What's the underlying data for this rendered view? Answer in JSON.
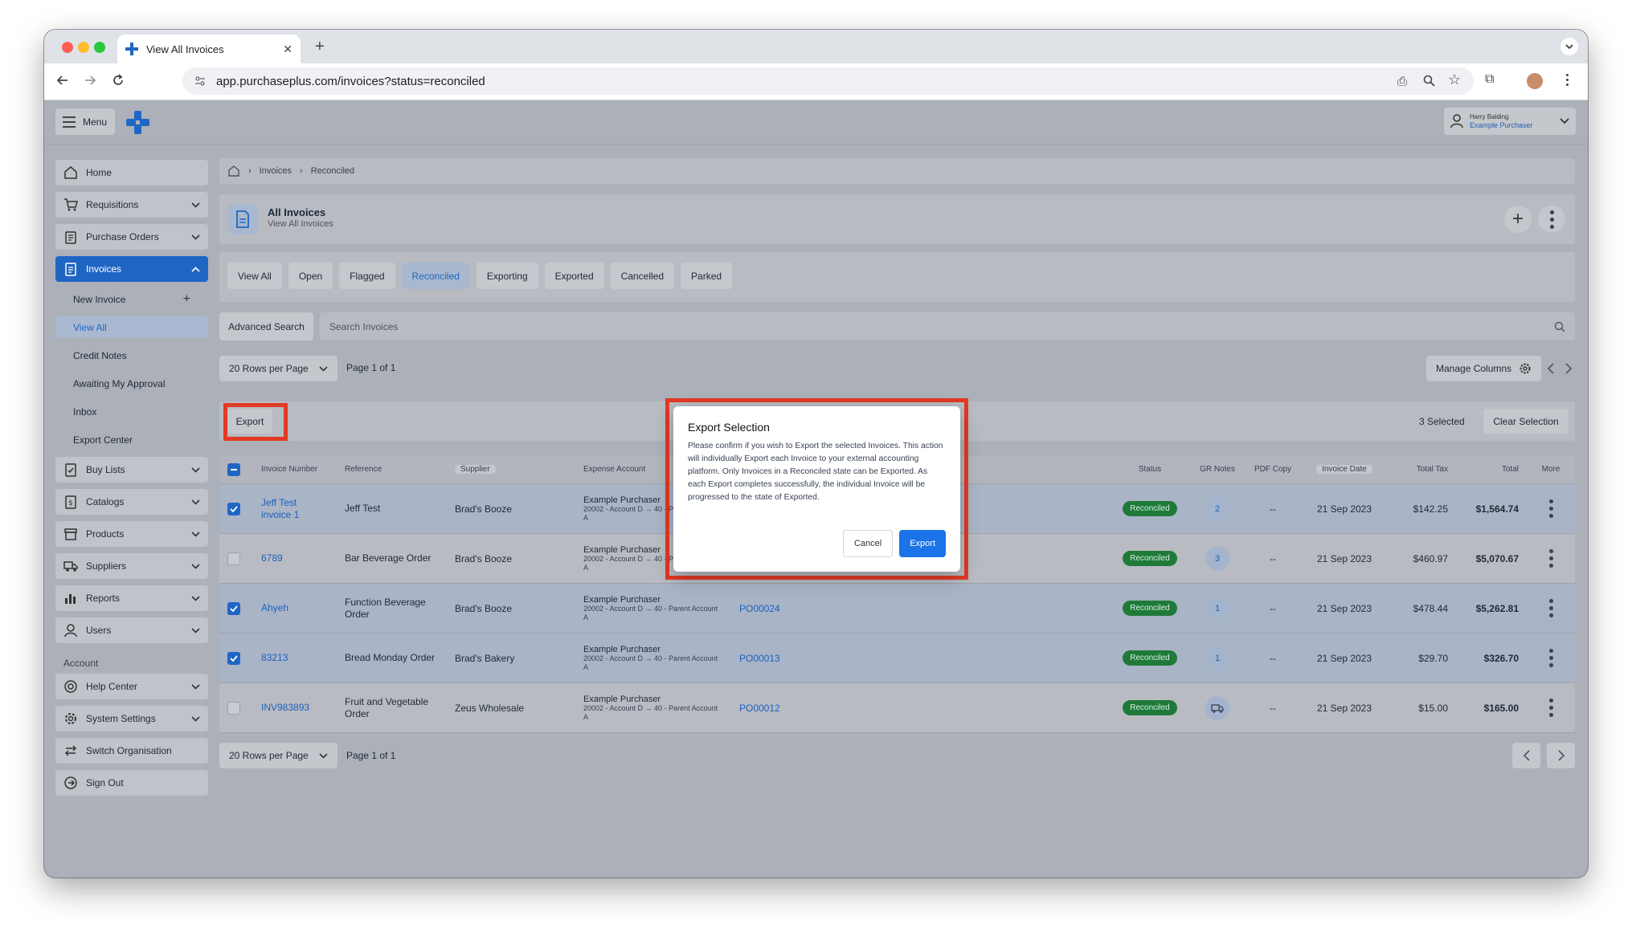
{
  "browser": {
    "tab_title": "View All Invoices",
    "url": "app.purchaseplus.com/invoices?status=reconciled"
  },
  "topbar": {
    "menu_label": "Menu",
    "user_name": "Harry Balding",
    "org_name": "Example Purchaser"
  },
  "sidebar": {
    "items": [
      {
        "label": "Home"
      },
      {
        "label": "Requisitions"
      },
      {
        "label": "Purchase Orders"
      },
      {
        "label": "Invoices"
      }
    ],
    "invoice_sub": [
      {
        "label": "New Invoice"
      },
      {
        "label": "View All"
      },
      {
        "label": "Credit Notes"
      },
      {
        "label": "Awaiting My Approval"
      },
      {
        "label": "Inbox"
      },
      {
        "label": "Export Center"
      }
    ],
    "items2": [
      {
        "label": "Buy Lists"
      },
      {
        "label": "Catalogs"
      },
      {
        "label": "Products"
      },
      {
        "label": "Suppliers"
      },
      {
        "label": "Reports"
      },
      {
        "label": "Users"
      }
    ],
    "account_label": "Account",
    "account_items": [
      {
        "label": "Help Center"
      },
      {
        "label": "System Settings"
      },
      {
        "label": "Switch Organisation"
      },
      {
        "label": "Sign Out"
      }
    ]
  },
  "breadcrumb": {
    "items": [
      "Invoices",
      "Reconciled"
    ]
  },
  "header": {
    "title": "All Invoices",
    "subtitle": "View All Invoices"
  },
  "filters": [
    "View All",
    "Open",
    "Flagged",
    "Reconciled",
    "Exporting",
    "Exported",
    "Cancelled",
    "Parked"
  ],
  "search": {
    "advanced_label": "Advanced Search",
    "placeholder": "Search Invoices"
  },
  "pagination": {
    "rows_label": "20 Rows per Page",
    "page_label": "Page 1 of 1",
    "manage_columns": "Manage Columns"
  },
  "selection": {
    "export_label": "Export",
    "selected_count": "3 Selected",
    "clear_label": "Clear Selection"
  },
  "table": {
    "columns": [
      "Invoice Number",
      "Reference",
      "Supplier",
      "Expense Account",
      "Status",
      "GR Notes",
      "PDF Copy",
      "Invoice Date",
      "Total Tax",
      "Total",
      "More"
    ],
    "rows": [
      {
        "number": "Jeff Test invoice 1",
        "reference": "Jeff Test",
        "supplier": "Brad's Booze",
        "acct_name": "Example Purchaser",
        "acct_detail": "20002 - Account D → 40 - Parent Account A",
        "po": "",
        "status": "Reconciled",
        "gr": "2",
        "pdf": "--",
        "date": "21 Sep 2023",
        "tax": "$142.25",
        "total": "$1,564.74",
        "checked": true
      },
      {
        "number": "6789",
        "reference": "Bar Beverage Order",
        "supplier": "Brad's Booze",
        "acct_name": "Example Purchaser",
        "acct_detail": "20002 - Account D → 40 - Parent Account A",
        "po": "",
        "status": "Reconciled",
        "gr": "3",
        "pdf": "--",
        "date": "21 Sep 2023",
        "tax": "$460.97",
        "total": "$5,070.67",
        "checked": false
      },
      {
        "number": "Ahyeh",
        "reference": "Function Beverage Order",
        "supplier": "Brad's Booze",
        "acct_name": "Example Purchaser",
        "acct_detail": "20002 - Account D → 40 - Parent Account A",
        "po": "PO00024",
        "status": "Reconciled",
        "gr": "1",
        "pdf": "--",
        "date": "21 Sep 2023",
        "tax": "$478.44",
        "total": "$5,262.81",
        "checked": true
      },
      {
        "number": "83213",
        "reference": "Bread Monday Order",
        "supplier": "Brad's Bakery",
        "acct_name": "Example Purchaser",
        "acct_detail": "20002 - Account D → 40 - Parent Account A",
        "po": "PO00013",
        "status": "Reconciled",
        "gr": "1",
        "pdf": "--",
        "date": "21 Sep 2023",
        "tax": "$29.70",
        "total": "$326.70",
        "checked": true
      },
      {
        "number": "INV983893",
        "reference": "Fruit and Vegetable Order",
        "supplier": "Zeus Wholesale",
        "acct_name": "Example Purchaser",
        "acct_detail": "20002 - Account D → 40 - Parent Account A",
        "po": "PO00012",
        "status": "Reconciled",
        "gr": "",
        "pdf": "--",
        "date": "21 Sep 2023",
        "tax": "$15.00",
        "total": "$165.00",
        "checked": false
      }
    ]
  },
  "modal": {
    "title": "Export Selection",
    "body": "Please confirm if you wish to Export the selected Invoices. This action will individually Export each Invoice to your external accounting platform. Only Invoices in a Reconciled state can be Exported. As each Export completes successfully, the individual Invoice will be progressed to the state of Exported.",
    "cancel": "Cancel",
    "confirm": "Export"
  },
  "colors": {
    "accent": "#1f66c4",
    "status_green": "#1f7a3a",
    "highlight_red": "#e23a24"
  }
}
